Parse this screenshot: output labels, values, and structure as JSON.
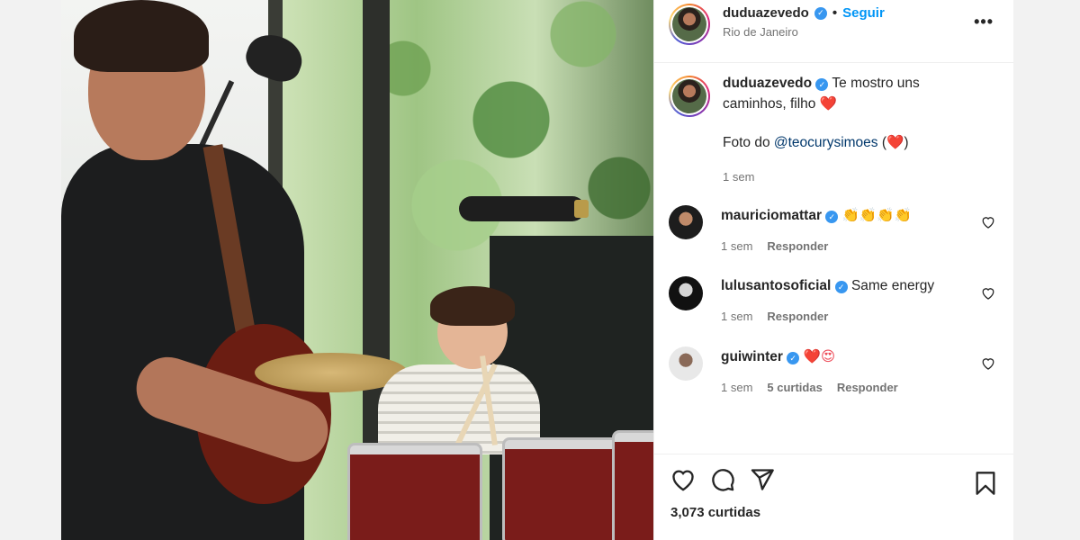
{
  "post": {
    "author": "duduazevedo",
    "follow_label": "Seguir",
    "location": "Rio de Janeiro",
    "more_label": "•••"
  },
  "caption": {
    "username": "duduazevedo",
    "text_line1": "Te mostro uns caminhos, filho",
    "heart": "❤️",
    "credit_prefix": "Foto do",
    "credit_mention": "@teocurysimoes",
    "credit_open": "(",
    "credit_heart": "❤️",
    "credit_close": ")",
    "time": "1 sem"
  },
  "comments": [
    {
      "username": "mauriciomattar",
      "text": "👏👏👏👏",
      "time": "1 sem",
      "reply": "Responder"
    },
    {
      "username": "lulusantosoficial",
      "text": "Same energy",
      "time": "1 sem",
      "reply": "Responder"
    },
    {
      "username": "guiwinter",
      "text": "❤️😍",
      "time": "1 sem",
      "likes": "5 curtidas",
      "reply": "Responder"
    }
  ],
  "footer": {
    "likes": "3,073 curtidas"
  },
  "icons": {
    "like": "heart-icon",
    "comment": "comment-icon",
    "share": "paper-plane-icon",
    "save": "bookmark-icon",
    "verified": "verified-badge-icon"
  }
}
